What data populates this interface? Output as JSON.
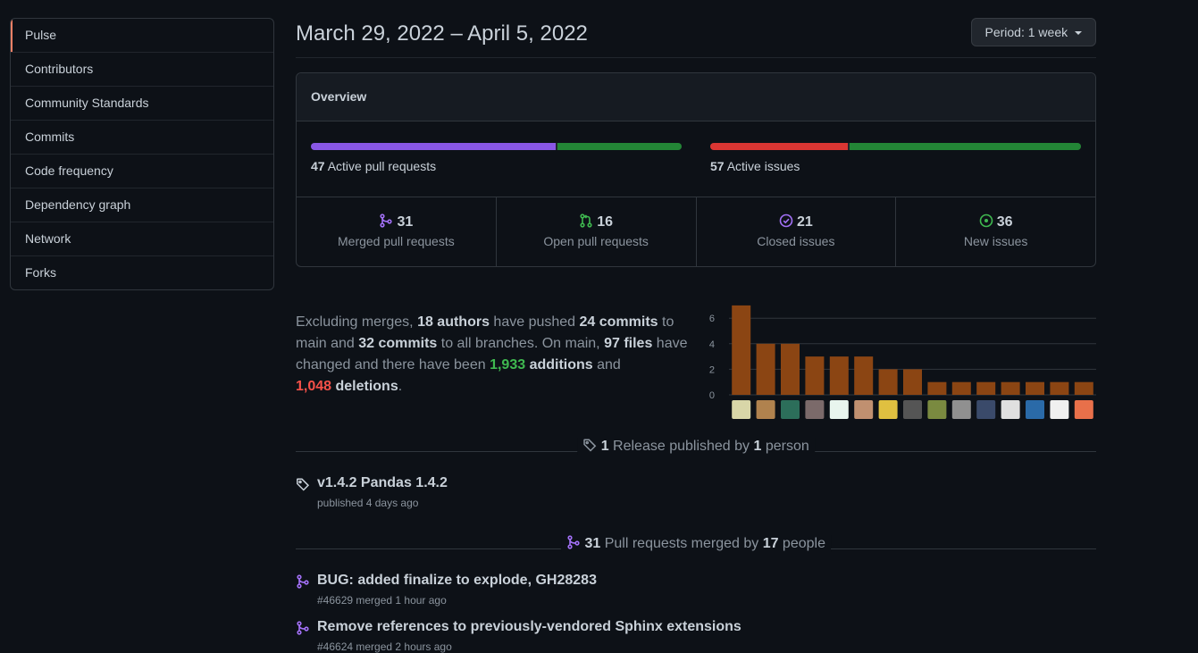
{
  "sidebar": {
    "items": [
      {
        "label": "Pulse",
        "selected": true
      },
      {
        "label": "Contributors"
      },
      {
        "label": "Community Standards"
      },
      {
        "label": "Commits"
      },
      {
        "label": "Code frequency"
      },
      {
        "label": "Dependency graph"
      },
      {
        "label": "Network"
      },
      {
        "label": "Forks"
      }
    ]
  },
  "header": {
    "date_range": "March 29, 2022 – April 5, 2022",
    "period_label": "Period:",
    "period_value": "1 week"
  },
  "overview": {
    "title": "Overview",
    "pull_requests": {
      "count": "47",
      "label": "Active pull requests",
      "merged_fraction": 0.66,
      "open_fraction": 0.34
    },
    "issues": {
      "count": "57",
      "label": "Active issues",
      "closed_fraction": 0.37,
      "new_fraction": 0.63
    },
    "stats": [
      {
        "icon": "merged-pr-icon",
        "value": "31",
        "label": "Merged pull requests",
        "color": "#a371f7"
      },
      {
        "icon": "open-pr-icon",
        "value": "16",
        "label": "Open pull requests",
        "color": "#3fb950"
      },
      {
        "icon": "closed-issue-icon",
        "value": "21",
        "label": "Closed issues",
        "color": "#a371f7"
      },
      {
        "icon": "new-issue-icon",
        "value": "36",
        "label": "New issues",
        "color": "#3fb950"
      }
    ]
  },
  "colors": {
    "merged": "#8957e5",
    "open": "#238636",
    "closed_issue": "#da3633",
    "bar": "#8b4513",
    "accent": "#f78166"
  },
  "summary": {
    "t1": "Excluding merges, ",
    "authors": "18 authors",
    "t2": " have pushed ",
    "commits_main": "24 commits",
    "t3": " to main and ",
    "commits_all": "32 commits",
    "t4": " to all branches. On main, ",
    "files": "97 files",
    "t5": " have changed and there have been ",
    "additions_num": "1,933",
    "additions_word": " additions",
    "t6": " and ",
    "deletions_num": "1,048",
    "deletions_word": " deletions",
    "t7": "."
  },
  "chart_data": {
    "type": "bar",
    "y_ticks": [
      "0",
      "2",
      "4",
      "6"
    ],
    "ylim": [
      0,
      7
    ],
    "values": [
      7,
      4,
      4,
      3,
      3,
      3,
      2,
      2,
      1,
      1,
      1,
      1,
      1,
      1,
      1
    ]
  },
  "releases": {
    "count": "1",
    "t1": " Release published by ",
    "people": "1",
    "t2": " person",
    "items": [
      {
        "title": "v1.4.2 Pandas 1.4.2",
        "meta": "published 4 days ago"
      }
    ]
  },
  "merged_prs": {
    "count": "31",
    "t1": " Pull requests merged by ",
    "people": "17",
    "t2": " people",
    "items": [
      {
        "title": "BUG: added finalize to explode, GH28283",
        "meta": "#46629 merged 1 hour ago"
      },
      {
        "title": "Remove references to previously-vendored Sphinx extensions",
        "meta": "#46624 merged 2 hours ago"
      }
    ]
  }
}
